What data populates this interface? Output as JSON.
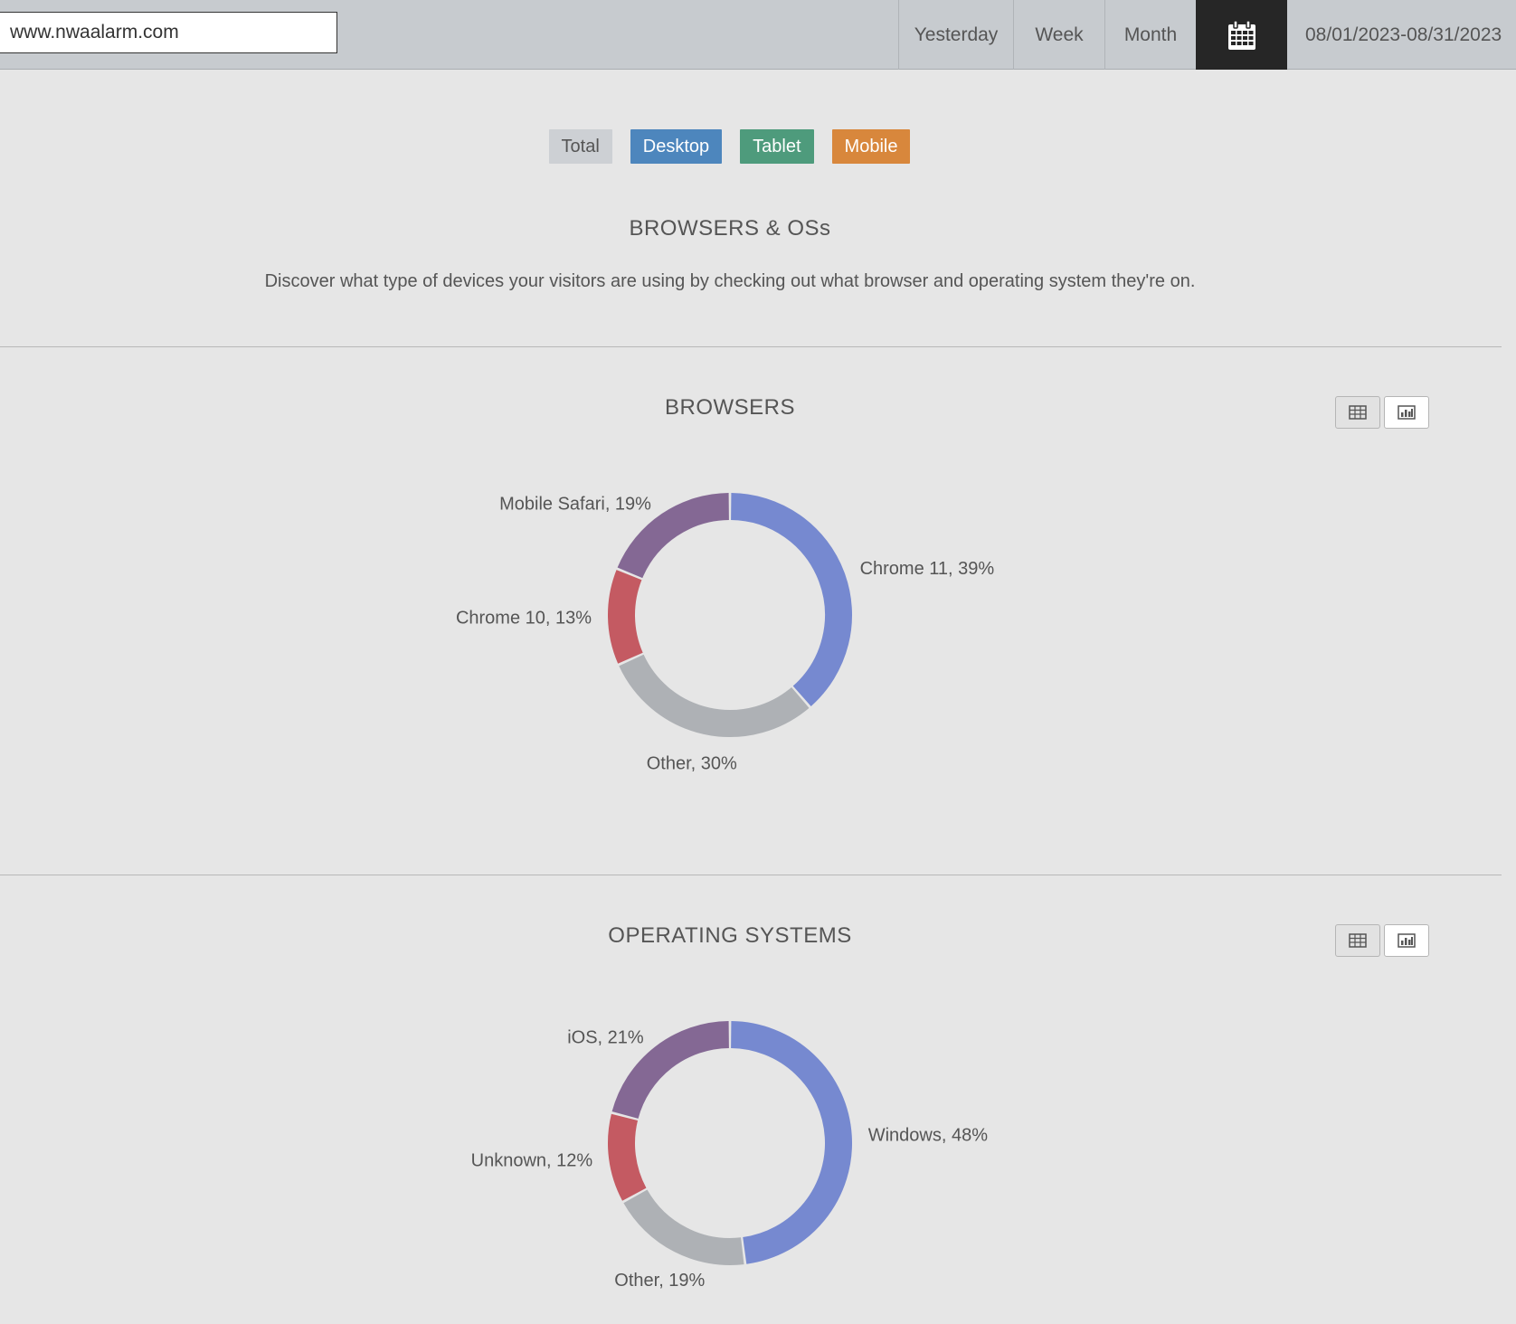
{
  "header": {
    "site_value": "www.nwaalarm.com",
    "ranges": {
      "yesterday": "Yesterday",
      "week": "Week",
      "month": "Month"
    },
    "calendar_icon": "calendar-icon",
    "date_range": "08/01/2023-08/31/2023"
  },
  "filters": {
    "total": "Total",
    "desktop": "Desktop",
    "tablet": "Tablet",
    "mobile": "Mobile"
  },
  "colors": {
    "desktop": "#4d86bd",
    "tablet": "#4e9b7c",
    "mobile": "#d8873c",
    "slice_blue": "#7689d0",
    "slice_gray": "#aeb1b5",
    "slice_red": "#c45a62",
    "slice_purple": "#846894"
  },
  "intro": {
    "title": "BROWSERS & OSs",
    "description": "Discover what type of devices your visitors are using by checking out what browser and operating system they're on."
  },
  "browsers": {
    "title": "BROWSERS",
    "icons": [
      "table-icon",
      "bar-chart-icon"
    ]
  },
  "operating_systems": {
    "title": "OPERATING SYSTEMS",
    "icons": [
      "table-icon",
      "bar-chart-icon"
    ]
  },
  "chart_data": [
    {
      "type": "pie",
      "title": "BROWSERS",
      "categories": [
        "Chrome 11",
        "Other",
        "Chrome 10",
        "Mobile Safari"
      ],
      "values": [
        39,
        30,
        13,
        19
      ],
      "labels": [
        "Chrome 11, 39%",
        "Other, 30%",
        "Chrome 10, 13%",
        "Mobile Safari, 19%"
      ]
    },
    {
      "type": "pie",
      "title": "OPERATING SYSTEMS",
      "categories": [
        "Windows",
        "Other",
        "Unknown",
        "iOS"
      ],
      "values": [
        48,
        19,
        12,
        21
      ],
      "labels": [
        "Windows, 48%",
        "Other, 19%",
        "Unknown, 12%",
        "iOS, 21%"
      ]
    }
  ]
}
